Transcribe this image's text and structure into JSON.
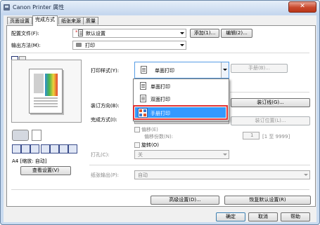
{
  "window": {
    "title": "Canon Printer 属性",
    "close_glyph": "✕"
  },
  "tabs": [
    {
      "label": "页面设置"
    },
    {
      "label": "完成方式"
    },
    {
      "label": "纸张来源"
    },
    {
      "label": "质量"
    }
  ],
  "profile": {
    "label": "配置文件(F):",
    "value": "默认设置",
    "add_button": "添加(1)...",
    "edit_button": "编辑(2)..."
  },
  "output": {
    "label": "输出方法(M):",
    "value": "打印"
  },
  "print_style": {
    "label": "打印样式(Y):",
    "value": "单面打印",
    "manual_button": "手册(B)..."
  },
  "print_style_options": [
    {
      "label": "单面打印"
    },
    {
      "label": "双面打印"
    },
    {
      "label": "手册打印"
    }
  ],
  "binding": {
    "direction_label": "装订方向(B):",
    "binding_button": "装订线(G)..."
  },
  "finishing": {
    "label": "完成方式(I):",
    "position_button": "装订位置(L)..."
  },
  "offset": {
    "label": "偏移(E)",
    "count_label": "偏移份数(N):",
    "count_value": "1",
    "range_text": "[1 至 9999]"
  },
  "rotate": {
    "label": "旋转(O)"
  },
  "punch": {
    "label": "打孔(C):",
    "value": "关"
  },
  "paper_output": {
    "label": "纸张输出(P):",
    "value": "自动"
  },
  "preview": {
    "caption": "A4 [缩放: 自动]",
    "view_settings_button": "查看设置(V)"
  },
  "advanced_button": "高级设置(D)...",
  "restore_defaults_button": "恢复默认设置(R)",
  "dialog_buttons": {
    "ok": "确定",
    "cancel": "取消",
    "help": "帮助"
  }
}
